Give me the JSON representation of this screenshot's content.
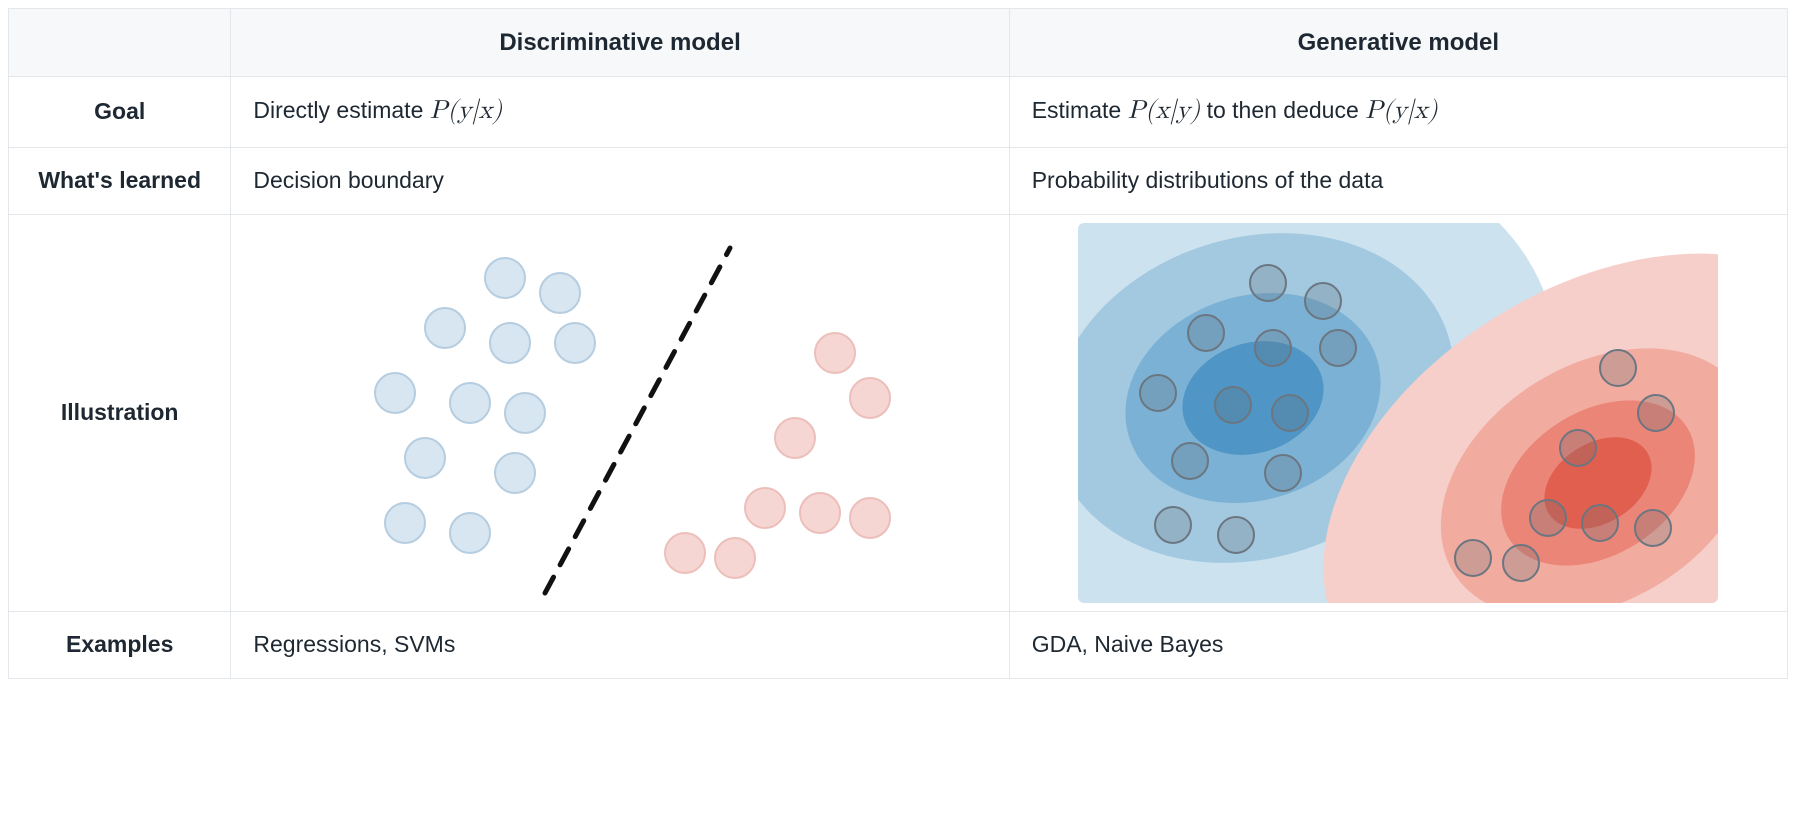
{
  "headers": {
    "col1": "Discriminative model",
    "col2": "Generative model"
  },
  "rows": {
    "goal": {
      "label": "Goal",
      "disc_pre": "Directly estimate ",
      "disc_math": "P(y|x)",
      "gen_pre": "Estimate ",
      "gen_math1": "P(x|y)",
      "gen_mid": " to then deduce ",
      "gen_math2": "P(y|x)"
    },
    "learned": {
      "label": "What's learned",
      "disc": "Decision boundary",
      "gen": "Probability distributions of the data"
    },
    "illustration": {
      "label": "Illustration"
    },
    "examples": {
      "label": "Examples",
      "disc": "Regressions, SVMs",
      "gen": "GDA, Naive Bayes"
    }
  }
}
